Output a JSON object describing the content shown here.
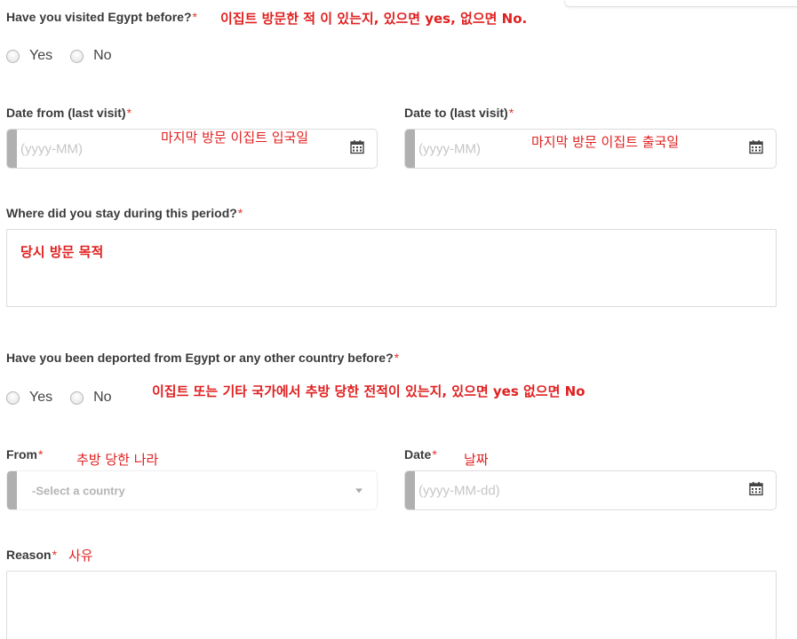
{
  "q_visited": {
    "label": "Have you visited Egypt before?",
    "required": "*",
    "note": "이집트 방문한 적 이 있는지, 있으면 yes, 없으면 No.",
    "options": [
      "Yes",
      "No"
    ]
  },
  "date_from": {
    "label": "Date from (last visit)",
    "required": "*",
    "placeholder": "(yyyy-MM)",
    "note": "마지막 방문 이집트 입국일"
  },
  "date_to": {
    "label": "Date to (last visit)",
    "required": "*",
    "placeholder": "(yyyy-MM)",
    "note": "마지막 방문 이집트 출국일"
  },
  "stay": {
    "label": "Where did you stay during this period?",
    "required": "*",
    "note": "당시 방문 목적"
  },
  "q_deported": {
    "label": "Have you been deported from Egypt or any other country before?",
    "required": "*",
    "note": "이집트 또는 기타 국가에서 추방 당한 전적이 있는지, 있으면 yes 없으면 No",
    "options": [
      "Yes",
      "No"
    ]
  },
  "from_country": {
    "label": "From",
    "required": "*",
    "note": "추방 당한 나라",
    "placeholder": "-Select a country"
  },
  "deport_date": {
    "label": "Date",
    "required": "*",
    "note": "날짜",
    "placeholder": "(yyyy-MM-dd)"
  },
  "reason": {
    "label": "Reason",
    "required": "*",
    "note": "사유"
  },
  "icons": {
    "calendar": "calendar-icon",
    "radio": "radio-button",
    "dropdown": "chevron-down-icon"
  },
  "colors": {
    "required_mark": "#e0342c",
    "annotation": "#e02020",
    "input_stripe": "#b0b0b0",
    "border": "#dcdcdc"
  }
}
